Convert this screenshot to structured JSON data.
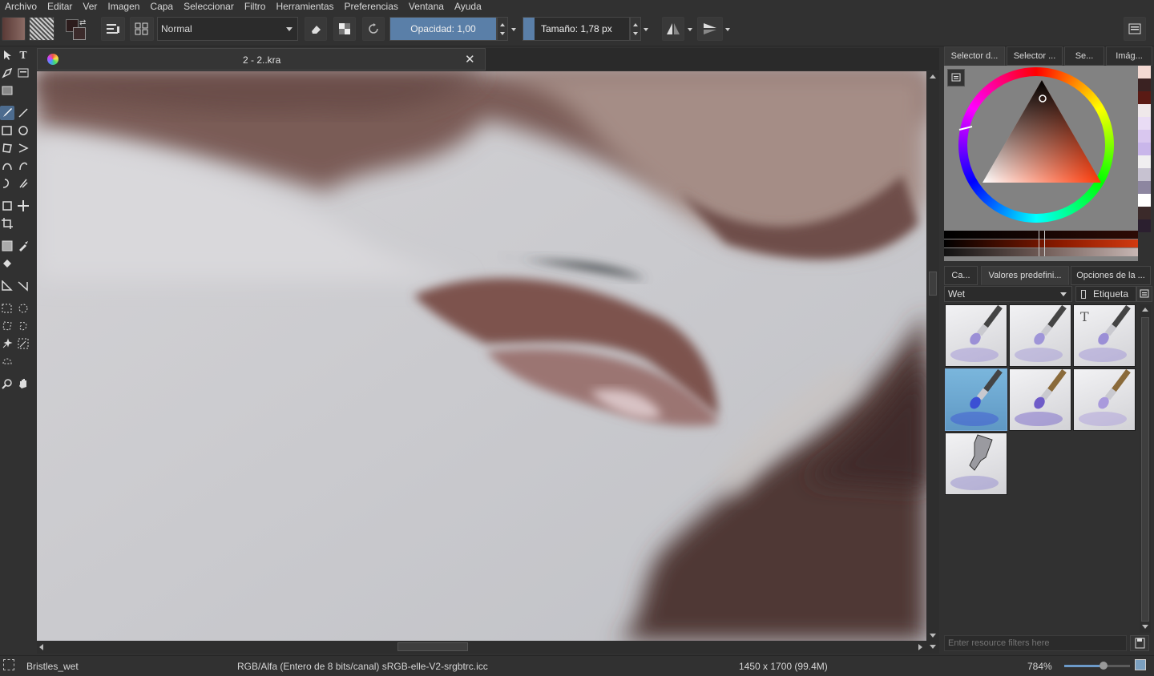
{
  "menu": [
    "Archivo",
    "Editar",
    "Ver",
    "Imagen",
    "Capa",
    "Seleccionar",
    "Filtro",
    "Herramientas",
    "Preferencias",
    "Ventana",
    "Ayuda"
  ],
  "toolbar": {
    "blend_mode": "Normal",
    "opacity_label": "Opacidad:  1,00",
    "opacity_value": 1.0,
    "size_label": "Tamaño:  1,78 px",
    "size_fraction": 0.02
  },
  "document": {
    "tab_title": "2 - 2..kra"
  },
  "docker": {
    "top_tabs": [
      "Selector d...",
      "Selector ...",
      "Se...",
      "Imág..."
    ],
    "bottom_tabs": [
      "Ca...",
      "Valores predefini...",
      "Opciones de la ..."
    ],
    "tag_filter": "Wet",
    "tag_button": "Etiqueta",
    "filter_placeholder": "Enter resource filters here",
    "swatches": [
      "#f3d9d2",
      "#3a2222",
      "#5a1a14",
      "#efe8ea",
      "#e9dcf5",
      "#d9c7ef",
      "#c9b6ea",
      "#f0eef0",
      "#c7c2d1",
      "#8d86a0",
      "#ffffff",
      "#3b2a2a",
      "#2b1f2f"
    ],
    "presets": [
      {
        "name": "wet-brush-1",
        "tip": "#9b8fd6"
      },
      {
        "name": "wet-brush-2",
        "tip": "#9f95d8"
      },
      {
        "name": "wet-brush-text",
        "tip": "#9b8fd6"
      },
      {
        "name": "wet-brush-4",
        "tip": "#3b4fd4"
      },
      {
        "name": "wet-brush-5",
        "tip": "#6f5cc8"
      },
      {
        "name": "wet-brush-6",
        "tip": "#a99adc"
      },
      {
        "name": "wet-airbrush",
        "tip": "#8d86cf"
      }
    ]
  },
  "status": {
    "brush_name": "Bristles_wet",
    "color_space": "RGB/Alfa (Entero de 8 bits/canal)  sRGB-elle-V2-srgbtrc.icc",
    "image_size": "1450 x 1700 (99.4M)",
    "zoom": "784%"
  }
}
